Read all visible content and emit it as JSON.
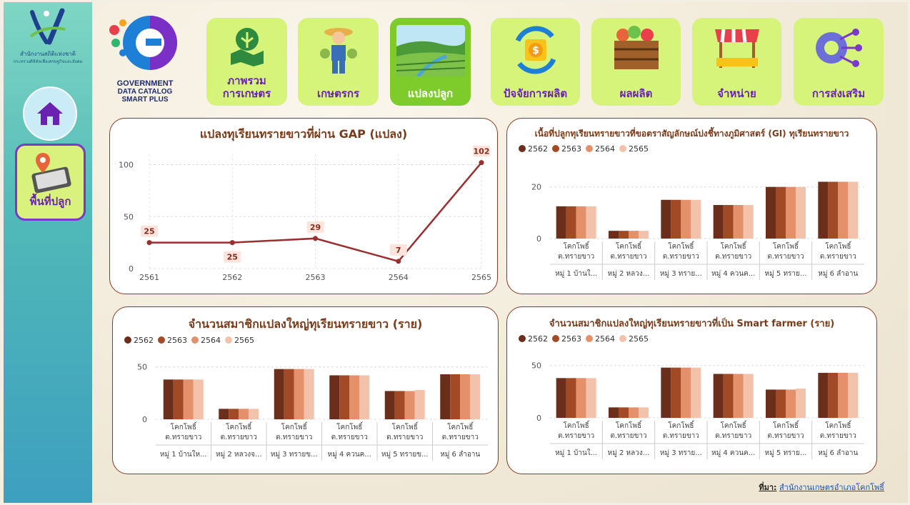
{
  "agency": {
    "name": "สำนักงานสถิติแห่งชาติ",
    "sub": "กระทรวงดิจิทัลเพื่อเศรษฐกิจและสังคม"
  },
  "sidebar": {
    "area_label": "พื้นที่ปลูก"
  },
  "logo": {
    "line1": "GOVERNMENT",
    "line2": "DATA CATALOG",
    "line3": "SMART PLUS"
  },
  "nav": [
    {
      "label": "ภาพรวม\nการเกษตร"
    },
    {
      "label": "เกษตรกร"
    },
    {
      "label": "แปลงปลูก"
    },
    {
      "label": "ปัจจัยการผลิต"
    },
    {
      "label": "ผลผลิต"
    },
    {
      "label": "จำหน่าย"
    },
    {
      "label": "การส่งเสริม"
    }
  ],
  "colors": {
    "y2562": "#6b2e1a",
    "y2563": "#a24a25",
    "y2564": "#e4906a",
    "y2565": "#f3c2ab",
    "line": "#9b2f2f"
  },
  "charts": {
    "gap": {
      "title": "แปลงทุเรียนทรายขาวที่ผ่าน GAP (แปลง)"
    },
    "gi": {
      "title": "เนื้อที่ปลูกทุเรียนทรายขาวที่ขอตราสัญลักษณ์บ่งชี้ทางภูมิศาสตร์ (GI) ทุเรียนทรายขาว"
    },
    "members": {
      "title": "จำนวนสมาชิกแปลงใหญ่ทุเรียนทรายขาว (ราย)"
    },
    "smart": {
      "title": "จำนวนสมาชิกแปลงใหญ่ทุเรียนทรายขาวที่เป็น Smart farmer (ราย)"
    }
  },
  "legend_years": [
    "2562",
    "2563",
    "2564",
    "2565"
  ],
  "source": {
    "label": "ที่มา:",
    "value": "สำนักงานเกษตรอำเภอโคกโพธิ์"
  },
  "chart_data": [
    {
      "type": "line",
      "title": "แปลงทุเรียนทรายขาวที่ผ่าน GAP (แปลง)",
      "x": [
        "2561",
        "2562",
        "2563",
        "2564",
        "2565"
      ],
      "values": [
        25,
        25,
        29,
        7,
        102
      ],
      "yticks": [
        0,
        50,
        100
      ],
      "ylim": [
        0,
        110
      ]
    },
    {
      "type": "bar",
      "title": "เนื้อที่ปลูกทุเรียนทรายขาวที่ขอตราสัญลักษณ์บ่งชี้ทางภูมิศาสตร์ (GI) ทุเรียนทรายขาว",
      "group_label": [
        "โคกโพธิ์",
        "ต.ทรายขาว"
      ],
      "categories": [
        "หมู่ 1 บ้านใ...",
        "หมู่ 2 หลวง...",
        "หมู่ 3 ทราย...",
        "หมู่ 4 ควนค...",
        "หมู่ 5 ทราย...",
        "หมู่ 6 ลำอาน"
      ],
      "series": [
        {
          "name": "2562",
          "values": [
            12.5,
            3,
            15,
            13,
            20,
            22
          ]
        },
        {
          "name": "2563",
          "values": [
            12.5,
            3,
            15,
            13,
            20,
            22
          ]
        },
        {
          "name": "2564",
          "values": [
            12.5,
            3,
            15,
            13,
            20,
            22
          ]
        },
        {
          "name": "2565",
          "values": [
            12.5,
            3,
            15,
            13,
            20,
            22
          ]
        }
      ],
      "yticks": [
        0,
        20
      ],
      "ylim": [
        0,
        26
      ]
    },
    {
      "type": "bar",
      "title": "จำนวนสมาชิกแปลงใหญ่ทุเรียนทรายขาว (ราย)",
      "group_label": [
        "โคกโพธิ์",
        "ต.ทรายขาว"
      ],
      "categories": [
        "หมู่ 1 บ้านให...",
        "หมู่ 2 หลวงจ...",
        "หมู่ 3 ทรายข...",
        "หมู่ 4 ควนค...",
        "หมู่ 5 ทรายข...",
        "หมู่ 6 ลำอาน"
      ],
      "series": [
        {
          "name": "2562",
          "values": [
            38,
            10,
            48,
            42,
            27,
            43
          ]
        },
        {
          "name": "2563",
          "values": [
            38,
            10,
            48,
            42,
            27,
            43
          ]
        },
        {
          "name": "2564",
          "values": [
            38,
            10,
            48,
            42,
            27,
            43
          ]
        },
        {
          "name": "2565",
          "values": [
            38,
            10,
            48,
            42,
            28,
            43
          ]
        }
      ],
      "yticks": [
        0,
        50
      ],
      "ylim": [
        0,
        58
      ]
    },
    {
      "type": "bar",
      "title": "จำนวนสมาชิกแปลงใหญ่ทุเรียนทรายขาวที่เป็น Smart farmer (ราย)",
      "group_label": [
        "โคกโพธิ์",
        "ต.ทรายขาว"
      ],
      "categories": [
        "หมู่ 1 บ้านใ...",
        "หมู่ 2 หลวง...",
        "หมู่ 3 ทราย...",
        "หมู่ 4 ควนค...",
        "หมู่ 5 ทราย...",
        "หมู่ 6 ลำอาน"
      ],
      "series": [
        {
          "name": "2562",
          "values": [
            38,
            10,
            48,
            42,
            27,
            43
          ]
        },
        {
          "name": "2563",
          "values": [
            38,
            10,
            48,
            42,
            27,
            43
          ]
        },
        {
          "name": "2564",
          "values": [
            38,
            10,
            48,
            42,
            27,
            43
          ]
        },
        {
          "name": "2565",
          "values": [
            38,
            10,
            48,
            42,
            28,
            43
          ]
        }
      ],
      "yticks": [
        0,
        50
      ],
      "ylim": [
        0,
        58
      ]
    }
  ]
}
